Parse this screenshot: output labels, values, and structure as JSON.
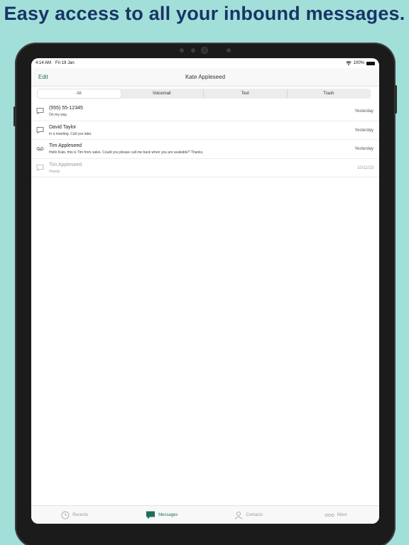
{
  "headline": "Easy access to all your inbound messages.",
  "status_bar": {
    "time": "4:14 AM",
    "date": "Fri 19 Jan",
    "battery": "100%"
  },
  "navbar": {
    "edit_label": "Edit",
    "title": "Kate Appleseed"
  },
  "segments": [
    "All",
    "Voicemail",
    "Text",
    "Trash"
  ],
  "selected_segment": "All",
  "messages": [
    {
      "name": "(555) 55-12345",
      "snippet": "On my way",
      "time": "Yesterday",
      "icon": "message-bubble-icon"
    },
    {
      "name": "David Taylor",
      "snippet": "In a meeting. Call you later.",
      "time": "Yesterday",
      "icon": "message-bubble-icon"
    },
    {
      "name": "Tim Appleseed",
      "snippet": "Hello Kate, this is Tim from sales. Could you please call me back when you are available? Thanks.",
      "time": "Yesterday",
      "icon": "voicemail-icon"
    },
    {
      "name": "Tim Appleseed",
      "snippet": "Howdy",
      "time": "10/11/23",
      "icon": "message-bubble-icon"
    }
  ],
  "tabbar": {
    "tabs": [
      {
        "label": "Recents",
        "icon": "clock-icon"
      },
      {
        "label": "Messages",
        "icon": "message-bubble-icon"
      },
      {
        "label": "Contacts",
        "icon": "person-icon"
      },
      {
        "label": "More",
        "icon": "ellipsis-icon"
      }
    ],
    "active": "Messages"
  },
  "colors": {
    "background": "#a3dfd9",
    "headline": "#173566",
    "accent": "#1f6d5c",
    "device": "#1b1b1b"
  }
}
